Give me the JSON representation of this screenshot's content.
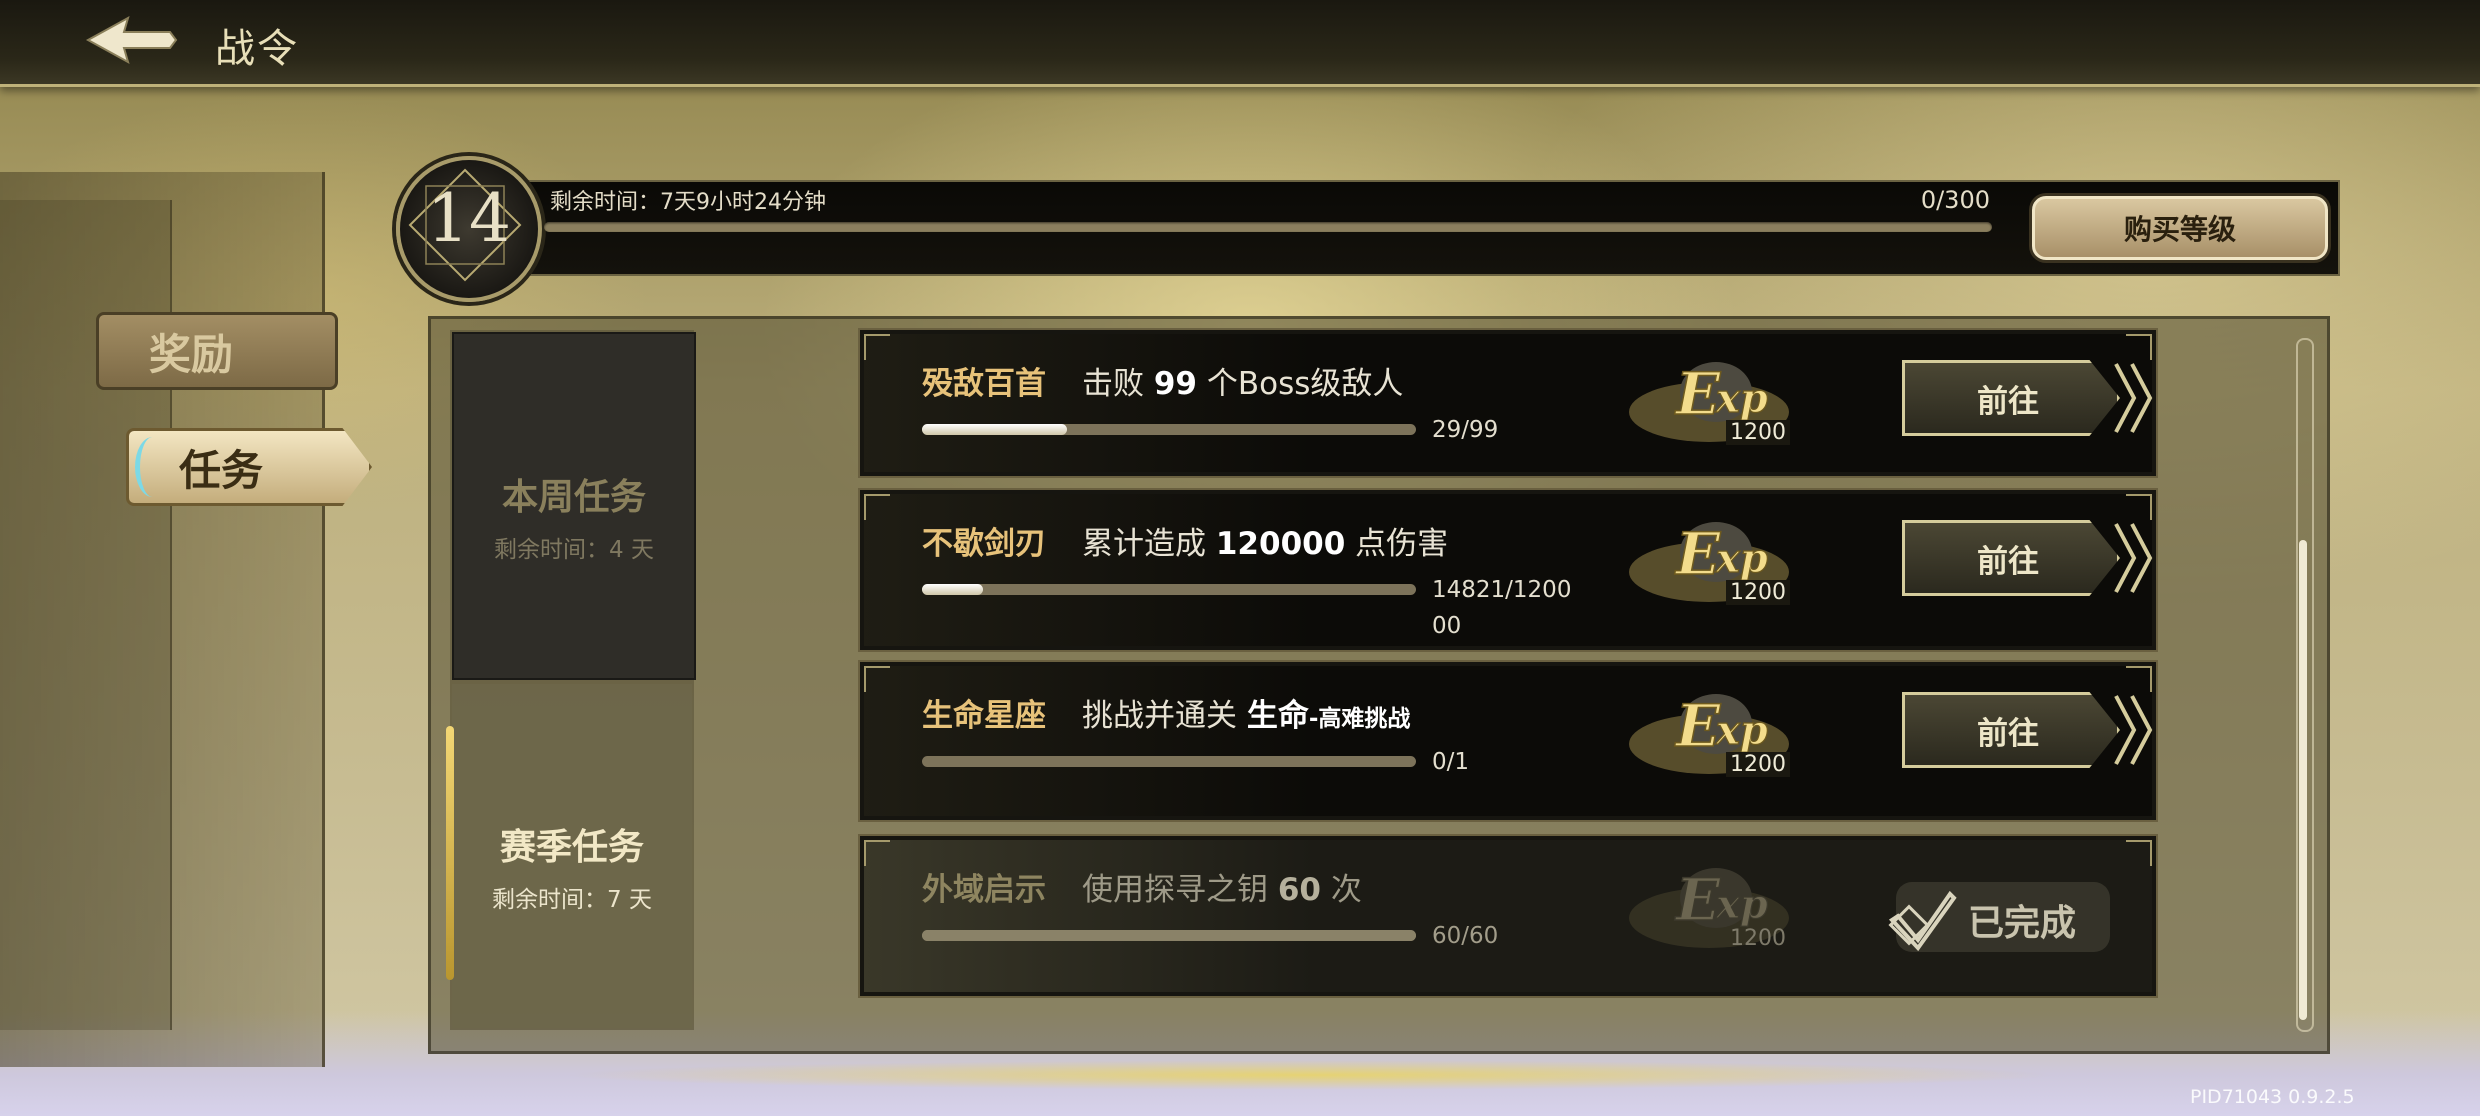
{
  "header": {
    "title": "战令"
  },
  "sidebar": {
    "tabs": [
      {
        "label": "奖励"
      },
      {
        "label": "任务"
      }
    ]
  },
  "level": {
    "value": "14",
    "remaining_time": "剩余时间：7天9小时24分钟",
    "exp_progress": "0/300",
    "exp_fraction": 0.0,
    "buy_button": "购买等级"
  },
  "categories": {
    "weekly": {
      "title": "本周任务",
      "remaining": "剩余时间：4 天"
    },
    "season": {
      "title": "赛季任务",
      "remaining": "剩余时间：7 天"
    }
  },
  "quests": [
    {
      "name": "殁敌百首",
      "desc_pre": "击败 ",
      "desc_bold": "99",
      "desc_post": " 个Boss级敌人",
      "desc_small": "",
      "progress_line1": "29/99",
      "progress_line2": "",
      "progress_fraction": 0.293,
      "exp": "1200",
      "action": "前往",
      "completed": false
    },
    {
      "name": "不歇剑刃",
      "desc_pre": "累计造成 ",
      "desc_bold": "120000",
      "desc_post": " 点伤害",
      "desc_small": "",
      "progress_line1": "14821/1200",
      "progress_line2": "00",
      "progress_fraction": 0.1235,
      "exp": "1200",
      "action": "前往",
      "completed": false
    },
    {
      "name": "生命星座",
      "desc_pre": "挑战并通关 ",
      "desc_bold": "生命",
      "desc_post": "",
      "desc_small": "-高难挑战",
      "progress_line1": "0/1",
      "progress_line2": "",
      "progress_fraction": 0.0,
      "exp": "1200",
      "action": "前往",
      "completed": false
    },
    {
      "name": "外域启示",
      "desc_pre": "使用探寻之钥 ",
      "desc_bold": "60",
      "desc_post": " 次",
      "desc_small": "",
      "progress_line1": "60/60",
      "progress_line2": "",
      "progress_fraction": 1.0,
      "exp": "1200",
      "action": "已完成",
      "completed": true
    }
  ],
  "version": "PID71043  0.9.2.5",
  "colors": {
    "accent_gold": "#e7c27a",
    "panel_dark": "#0c0b08",
    "season_highlight": "#f3d775"
  }
}
